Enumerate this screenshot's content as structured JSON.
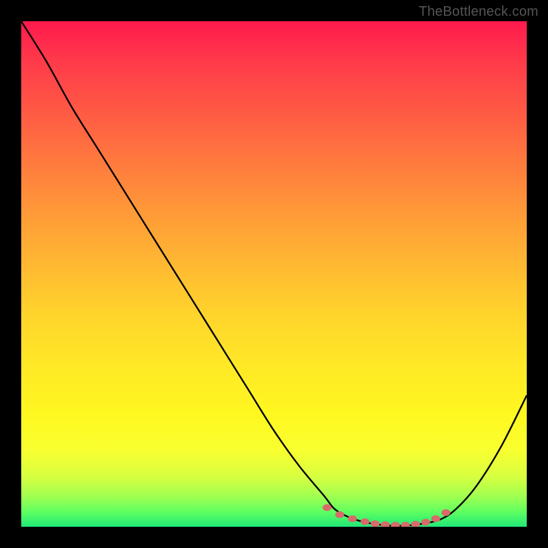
{
  "watermark": "TheBottleneck.com",
  "chart_data": {
    "type": "line",
    "title": "",
    "xlabel": "",
    "ylabel": "",
    "xlim": [
      0,
      100
    ],
    "ylim": [
      0,
      100
    ],
    "series": [
      {
        "name": "bottleneck-curve",
        "x": [
          0,
          5,
          10,
          15,
          20,
          25,
          30,
          35,
          40,
          45,
          50,
          55,
          60,
          62,
          65,
          68,
          71,
          74,
          77,
          80,
          83,
          86,
          90,
          95,
          100
        ],
        "y": [
          100,
          92,
          83,
          75,
          67,
          59,
          51,
          43,
          35,
          27,
          19,
          12,
          6,
          3.5,
          1.8,
          0.9,
          0.4,
          0.2,
          0.3,
          0.7,
          1.5,
          3.5,
          8,
          16,
          26
        ]
      }
    ],
    "optimal_zone_points": {
      "x": [
        60.5,
        63,
        65.5,
        68,
        70,
        72,
        74,
        76,
        78,
        80,
        82,
        84
      ],
      "y": [
        3.8,
        2.4,
        1.6,
        1.0,
        0.6,
        0.4,
        0.3,
        0.3,
        0.5,
        0.9,
        1.6,
        2.8
      ]
    },
    "gradient_desc": "vertical red-yellow-green heatmap (red=high bottleneck, green=optimal)"
  }
}
